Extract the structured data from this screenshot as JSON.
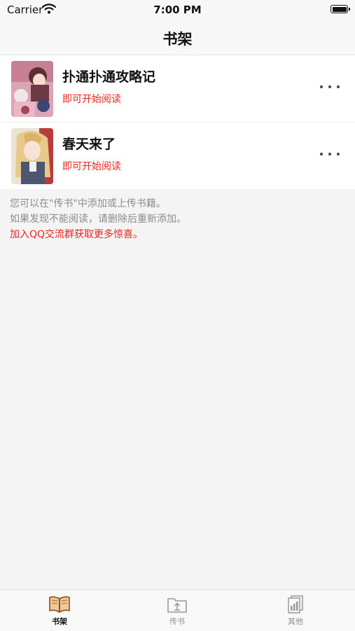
{
  "status_bar": {
    "carrier": "Carrier",
    "time": "7:00 PM"
  },
  "nav": {
    "title": "书架"
  },
  "books": [
    {
      "title": "扑通扑通攻略记",
      "status": "即可开始阅读"
    },
    {
      "title": "春天来了",
      "status": "即可开始阅读"
    }
  ],
  "notes": {
    "line1": "您可以在\"传书\"中添加或上传书籍。",
    "line2": "如果发现不能阅读，请删除后重新添加。",
    "line3": "加入QQ交流群获取更多惊喜。"
  },
  "tabbar": {
    "items": [
      {
        "label": "书架",
        "icon": "book-icon",
        "active": true
      },
      {
        "label": "传书",
        "icon": "upload-folder-icon",
        "active": false
      },
      {
        "label": "其他",
        "icon": "chart-document-icon",
        "active": false
      }
    ]
  },
  "colors": {
    "accent_red": "#e6261f",
    "active_icon": "#c8742c"
  }
}
